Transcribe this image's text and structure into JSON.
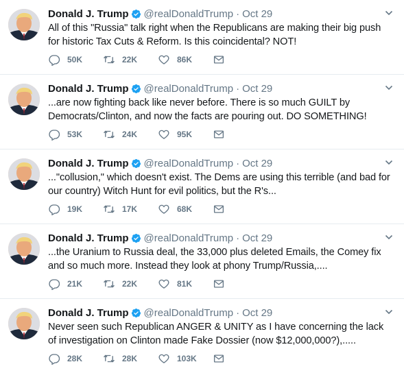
{
  "colors": {
    "verified": "#1da1f2",
    "meta": "#657786",
    "text": "#14171a",
    "divider": "#e6ecf0"
  },
  "icons": {
    "reply": "speech-bubble-icon",
    "retweet": "retweet-icon",
    "like": "heart-icon",
    "dm": "envelope-icon",
    "menu": "chevron-down-icon",
    "verified": "verified-badge-icon"
  },
  "tweets": [
    {
      "name": "Donald J. Trump",
      "handle": "@realDonaldTrump",
      "sep": "·",
      "time": "Oct 29",
      "text": "All of this \"Russia\" talk right when the Republicans are making their big push for historic Tax Cuts & Reform. Is this coincidental? NOT!",
      "replies": "50K",
      "retweets": "22K",
      "likes": "86K"
    },
    {
      "name": "Donald J. Trump",
      "handle": "@realDonaldTrump",
      "sep": "·",
      "time": "Oct 29",
      "text": "...are now fighting back like never before. There is so much GUILT by Democrats/Clinton, and now the facts are pouring out. DO SOMETHING!",
      "replies": "53K",
      "retweets": "24K",
      "likes": "95K"
    },
    {
      "name": "Donald J. Trump",
      "handle": "@realDonaldTrump",
      "sep": "·",
      "time": "Oct 29",
      "text": "...\"collusion,\" which doesn't exist. The Dems are using this terrible (and bad for our country) Witch Hunt for evil politics, but the R's...",
      "replies": "19K",
      "retweets": "17K",
      "likes": "68K"
    },
    {
      "name": "Donald J. Trump",
      "handle": "@realDonaldTrump",
      "sep": "·",
      "time": "Oct 29",
      "text": "...the Uranium to Russia deal, the  33,000 plus deleted Emails, the Comey fix and so much more. Instead they look at phony Trump/Russia,....",
      "replies": "21K",
      "retweets": "22K",
      "likes": "81K"
    },
    {
      "name": "Donald J. Trump",
      "handle": "@realDonaldTrump",
      "sep": "·",
      "time": "Oct 29",
      "text": "Never seen such Republican ANGER & UNITY as I have concerning the lack of investigation on Clinton made Fake Dossier (now $12,000,000?),.....",
      "replies": "28K",
      "retweets": "28K",
      "likes": "103K"
    }
  ]
}
